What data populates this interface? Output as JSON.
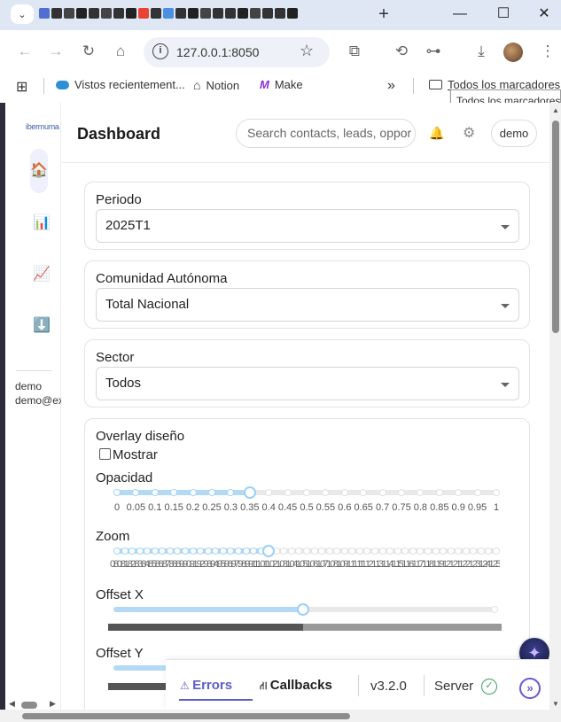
{
  "browser": {
    "new_tab": "+",
    "minimize": "—",
    "maximize": "☐",
    "close": "✕",
    "url": "127.0.0.1:8050",
    "bookmarks": [
      {
        "label": "Vistos recientement...",
        "icon": "salesforce-cloud-icon"
      },
      {
        "label": "Notion",
        "icon": "home-icon"
      },
      {
        "label": "Make",
        "icon": "make-logo-icon"
      }
    ],
    "bookmarks_overflow": "»",
    "all_bookmarks": "Todos los marcadores",
    "tooltip": "Todos los marcadores"
  },
  "sidebar": {
    "logo": "ibermuma",
    "items": [
      {
        "name": "home",
        "icon": "house-icon",
        "glyph": "🏠"
      },
      {
        "name": "bar-chart",
        "icon": "bar-chart-icon",
        "glyph": "📊"
      },
      {
        "name": "line-chart",
        "icon": "line-chart-icon",
        "glyph": "📈"
      },
      {
        "name": "download",
        "icon": "download-icon",
        "glyph": "⬇️"
      }
    ],
    "user_name": "demo",
    "user_email": "demo@ex"
  },
  "header": {
    "title": "Dashboard",
    "search_placeholder": "Search contacts, leads, oppor",
    "user_chip": "demo"
  },
  "filters": {
    "periodo": {
      "label": "Periodo",
      "value": "2025T1"
    },
    "comunidad": {
      "label": "Comunidad Autónoma",
      "value": "Total Nacional"
    },
    "sector": {
      "label": "Sector",
      "value": "Todos"
    }
  },
  "overlay": {
    "title": "Overlay diseño",
    "show_label": "Mostrar",
    "show_checked": false,
    "opacity": {
      "label": "Opacidad",
      "value": 0.35,
      "marks": [
        "0",
        "0.05",
        "0.1",
        "0.15",
        "0.2",
        "0.25",
        "0.3",
        "0.35",
        "0.4",
        "0.45",
        "0.5",
        "0.55",
        "0.6",
        "0.65",
        "0.7",
        "0.75",
        "0.8",
        "0.85",
        "0.9",
        "0.95",
        "1"
      ]
    },
    "zoom": {
      "label": "Zoom",
      "value_fraction": 0.4,
      "marks_text": "0.80.81.82.83.84.85.86.87.88.89.90.91.92.93.94.95.96.97.98.99111.011.021.031.041.051.061.071.081.091.11.111.121.131.141.151.161.171.181.191.21.211.221.231.241.251.261.271.281.291.3"
    },
    "offset_x": {
      "label": "Offset X",
      "value_fraction": 0.5
    },
    "offset_y": {
      "label": "Offset Y"
    }
  },
  "debug": {
    "errors": "Errors",
    "callbacks": "Callbacks",
    "version": "v3.2.0",
    "server": "Server"
  }
}
